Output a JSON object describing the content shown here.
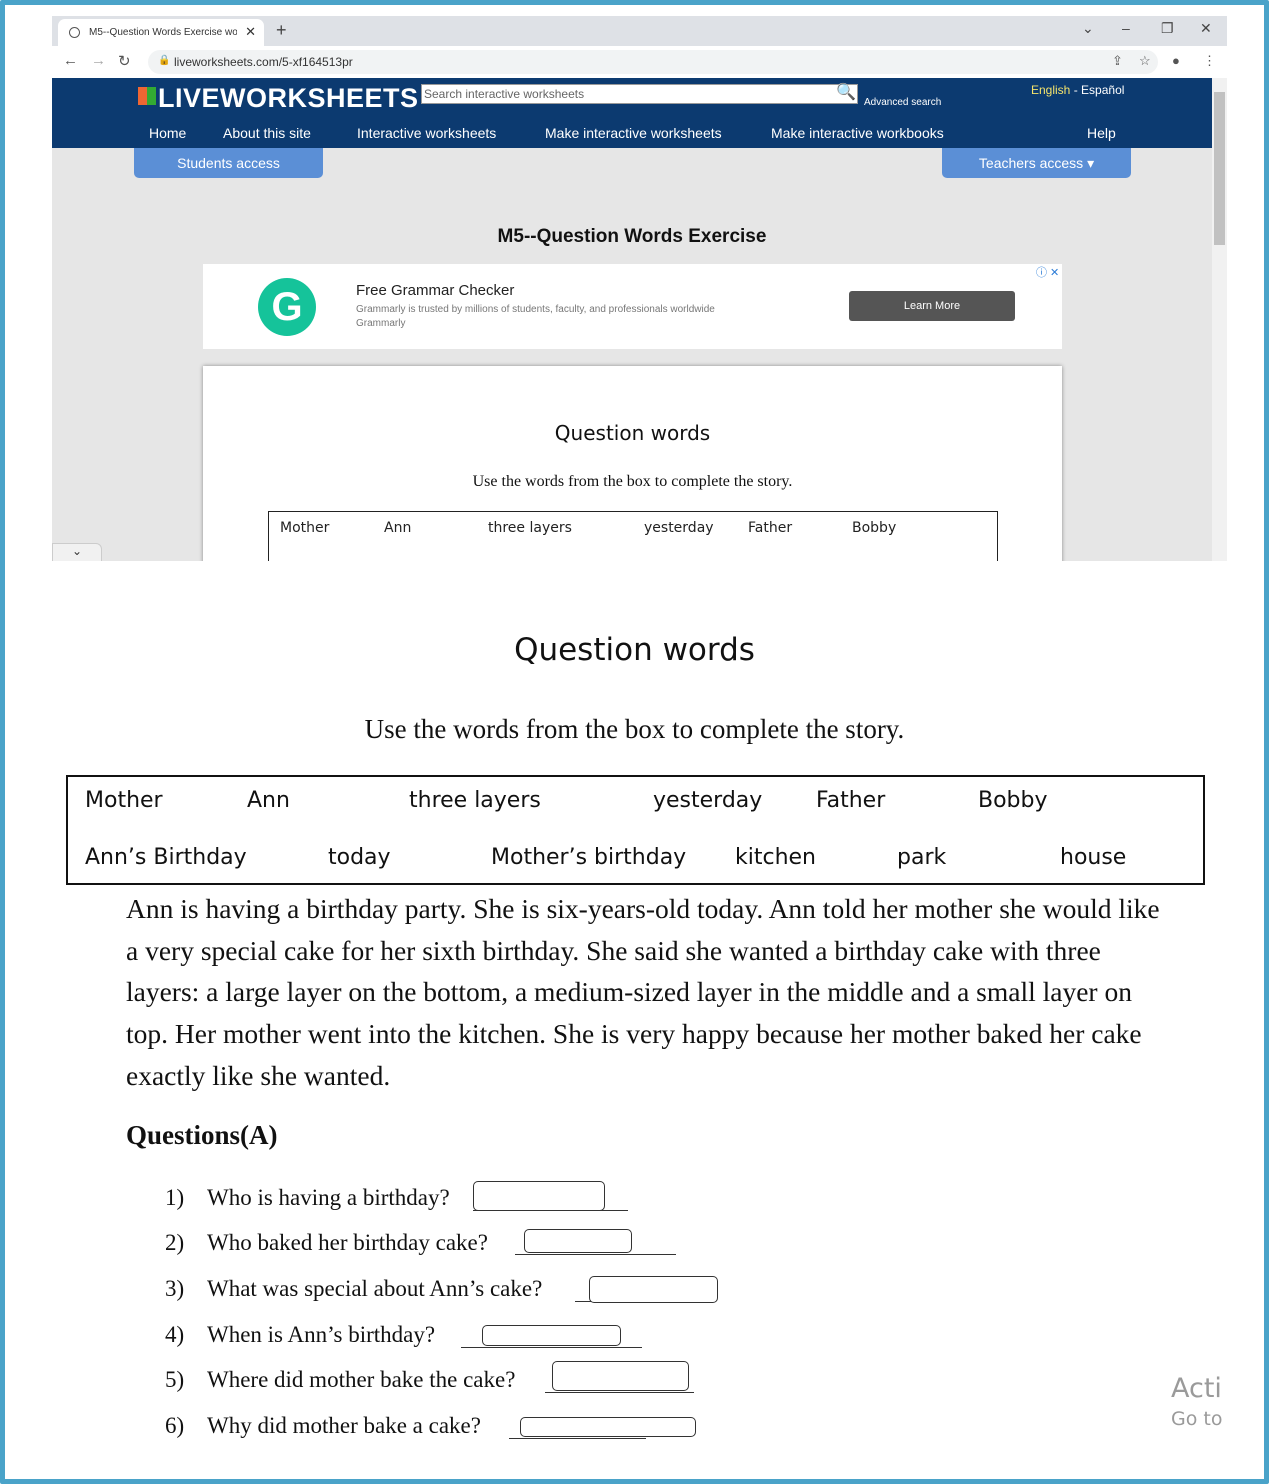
{
  "browser": {
    "tab_title": "M5--Question Words Exercise wo",
    "tab_close": "✕",
    "new_tab": "+",
    "url": "liveworksheets.com/5-xf164513pr"
  },
  "site": {
    "logo": "LIVEWORKSHEETS",
    "search_placeholder": "Search interactive worksheets",
    "advanced_search": "Advanced search",
    "lang_en": "English",
    "lang_sep": "-",
    "lang_es": "Español",
    "menu": [
      "Home",
      "About this site",
      "Interactive worksheets",
      "Make interactive worksheets",
      "Make interactive workbooks",
      "Help"
    ],
    "students_access": "Students access",
    "teachers_access": "Teachers access ▾",
    "page_title": "M5--Question Words Exercise"
  },
  "ad": {
    "headline": "Free Grammar Checker",
    "description": "Grammarly is trusted by millions of students, faculty, and professionals worldwide",
    "brand": "Grammarly",
    "button": "Learn More"
  },
  "worksheet": {
    "title": "Question words",
    "instruction": "Use the words from the box to complete the story.",
    "word_box_row1": [
      "Mother",
      "Ann",
      "three layers",
      "yesterday",
      "Father",
      "Bobby"
    ],
    "word_box_row2": [
      "Ann’s Birthday",
      "today",
      "Mother’s birthday",
      "kitchen",
      "park",
      "house"
    ],
    "story": "Ann is having a birthday party.  She is six-years-old today.  Ann told her mother she would like a very special cake for her sixth birthday.  She said she wanted a birthday cake with three layers: a large layer on the bottom, a medium-sized layer in the middle and a small layer on top.  Her mother went into the kitchen. She is very happy because her mother baked her cake exactly like she wanted.",
    "questions_heading": "Questions(A)",
    "questions": [
      {
        "num": "1)",
        "text": "Who is having a birthday?"
      },
      {
        "num": "2)",
        "text": "Who baked her birthday cake?"
      },
      {
        "num": "3)",
        "text": "What was special about Ann’s cake?"
      },
      {
        "num": "4)",
        "text": "When is Ann’s birthday?"
      },
      {
        "num": "5)",
        "text": "Where did mother bake the cake?"
      },
      {
        "num": "6)",
        "text": "Why did mother bake a cake?"
      }
    ]
  },
  "watermark": {
    "line1": "Acti",
    "line2": "Go to"
  }
}
